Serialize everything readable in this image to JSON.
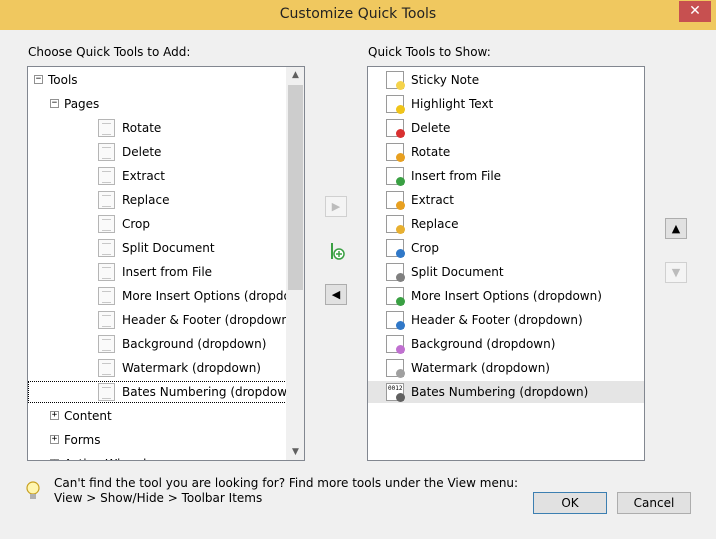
{
  "window": {
    "title": "Customize Quick Tools",
    "close_glyph": "✕"
  },
  "left": {
    "label": "Choose Quick Tools to Add:",
    "tree": [
      {
        "label": "Tools",
        "level": 0,
        "expander": "−",
        "icon": null
      },
      {
        "label": "Pages",
        "level": 1,
        "expander": "−",
        "icon": null
      },
      {
        "label": "Rotate",
        "level": 2,
        "icon": "rotate-icon"
      },
      {
        "label": "Delete",
        "level": 2,
        "icon": "delete-icon"
      },
      {
        "label": "Extract",
        "level": 2,
        "icon": "extract-icon"
      },
      {
        "label": "Replace",
        "level": 2,
        "icon": "replace-icon"
      },
      {
        "label": "Crop",
        "level": 2,
        "icon": "crop-icon"
      },
      {
        "label": "Split Document",
        "level": 2,
        "icon": "split-document-icon"
      },
      {
        "label": "Insert from File",
        "level": 2,
        "icon": "insert-from-file-icon"
      },
      {
        "label": "More Insert Options  (dropdown)",
        "level": 2,
        "icon": "more-insert-options-icon"
      },
      {
        "label": "Header & Footer  (dropdown)",
        "level": 2,
        "icon": "header-footer-icon"
      },
      {
        "label": "Background  (dropdown)",
        "level": 2,
        "icon": "background-icon"
      },
      {
        "label": "Watermark  (dropdown)",
        "level": 2,
        "icon": "watermark-icon"
      },
      {
        "label": "Bates Numbering  (dropdown)",
        "level": 2,
        "icon": "bates-numbering-icon",
        "focused": true
      },
      {
        "label": "Content",
        "level": 1,
        "expander": "+",
        "icon": null
      },
      {
        "label": "Forms",
        "level": 1,
        "expander": "+",
        "icon": null
      },
      {
        "label": "Action Wizard",
        "level": 1,
        "expander": "+",
        "icon": null
      }
    ]
  },
  "right": {
    "label": "Quick Tools to Show:",
    "items": [
      {
        "label": "Sticky Note",
        "icon": "sticky-note-icon",
        "color": "#f5d34a"
      },
      {
        "label": "Highlight Text",
        "icon": "highlight-text-icon",
        "color": "#f0c419"
      },
      {
        "label": "Delete",
        "icon": "delete-icon",
        "color": "#d93030"
      },
      {
        "label": "Rotate",
        "icon": "rotate-icon",
        "color": "#e8a020"
      },
      {
        "label": "Insert from File",
        "icon": "insert-from-file-icon",
        "color": "#3aa043"
      },
      {
        "label": "Extract",
        "icon": "extract-icon",
        "color": "#e8a020"
      },
      {
        "label": "Replace",
        "icon": "replace-icon",
        "color": "#e8b030"
      },
      {
        "label": "Crop",
        "icon": "crop-icon",
        "color": "#3078c8"
      },
      {
        "label": "Split Document",
        "icon": "split-document-icon",
        "color": "#808080"
      },
      {
        "label": "More Insert Options  (dropdown)",
        "icon": "more-insert-options-icon",
        "color": "#3aa043"
      },
      {
        "label": "Header & Footer  (dropdown)",
        "icon": "header-footer-icon",
        "color": "#3078c8"
      },
      {
        "label": "Background  (dropdown)",
        "icon": "background-icon",
        "color": "#c070d0"
      },
      {
        "label": "Watermark  (dropdown)",
        "icon": "watermark-icon",
        "color": "#a0a0a0"
      },
      {
        "label": "Bates Numbering  (dropdown)",
        "icon": "bates-numbering-icon",
        "color": "#606060",
        "selected": true,
        "badge": "0012"
      }
    ]
  },
  "middle": {
    "add_glyph": "▶",
    "insert_glyph": "|",
    "remove_glyph": "◀"
  },
  "order": {
    "up_glyph": "▲",
    "down_glyph": "▼"
  },
  "hint": {
    "line1": "Can't find the tool you are looking for? Find more tools under the View menu:",
    "line2": "View > Show/Hide > Toolbar Items"
  },
  "buttons": {
    "ok": "OK",
    "cancel": "Cancel"
  },
  "colors": {
    "titlebar": "#f0c85f",
    "close": "#c75050",
    "selection": "#e5e5e5"
  }
}
